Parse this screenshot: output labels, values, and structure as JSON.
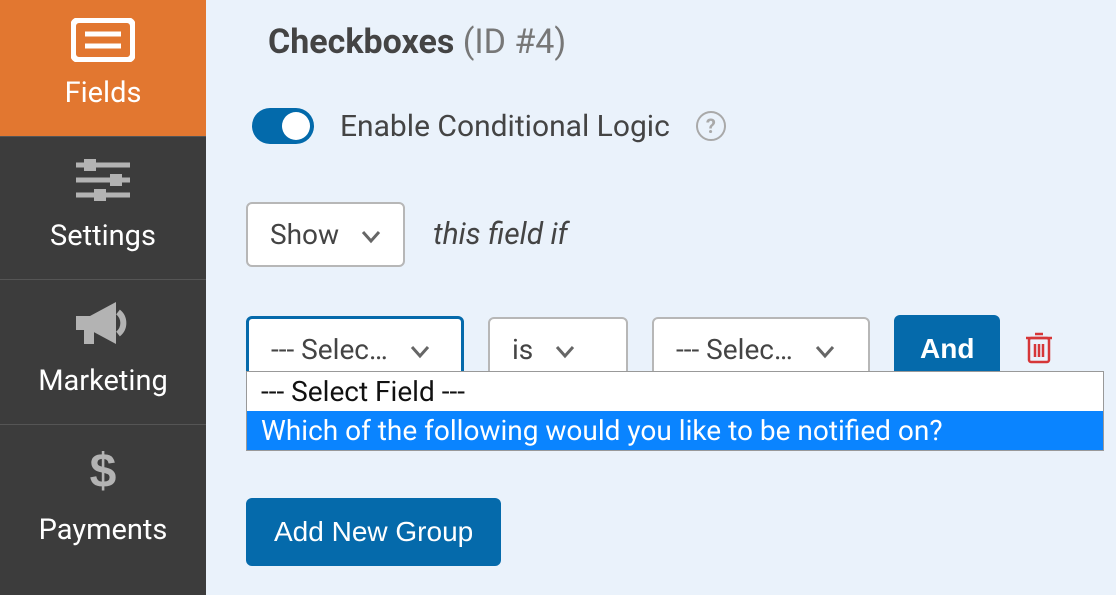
{
  "sidebar": {
    "items": [
      {
        "label": "Fields"
      },
      {
        "label": "Settings"
      },
      {
        "label": "Marketing"
      },
      {
        "label": "Payments"
      }
    ]
  },
  "header": {
    "field_type": "Checkboxes",
    "id_text": "(ID #4)"
  },
  "conditional": {
    "toggle_label": "Enable Conditional Logic",
    "enabled": true,
    "action": "Show",
    "action_suffix": "this field if",
    "rule": {
      "field": "--- Selec…",
      "operator": "is",
      "value": "--- Selec…",
      "joiner": "And"
    },
    "dropdown": {
      "options": [
        "--- Select Field ---",
        "Which of the following would you like to be notified on?"
      ],
      "hovered_index": 1
    },
    "add_group": "Add New Group"
  }
}
